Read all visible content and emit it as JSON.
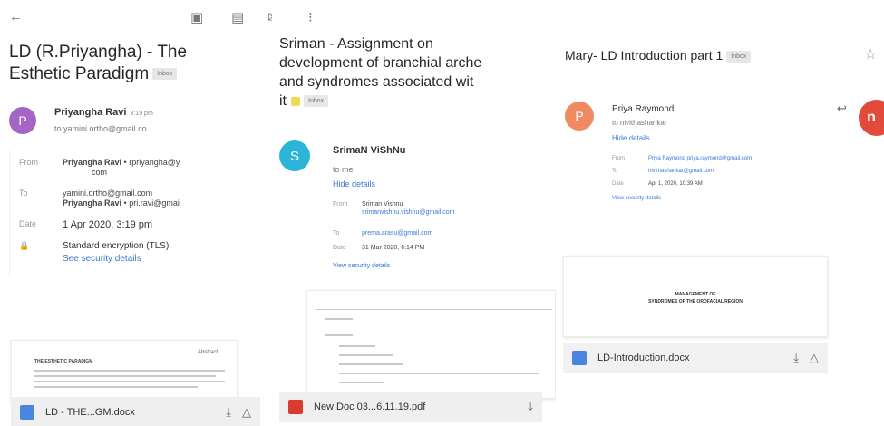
{
  "toolbar": {
    "back_glyph": "←",
    "archive_glyph": "▣",
    "delete_glyph": "▤",
    "mail_glyph": "✉",
    "more_glyph": "⁝"
  },
  "email1": {
    "subject_line1": "LD (R.Priyangha) - The",
    "subject_line2": "Esthetic Paradigm",
    "label": "Inbox",
    "avatar_letter": "P",
    "avatar_color": "#a565c7",
    "sender": "Priyangha Ravi",
    "time": "3:19 pm",
    "to_line": "to yamini.ortho@gmail.co...",
    "details": {
      "from_label": "From",
      "from_value": "Priyangha Ravi",
      "from_email": "• rpriyangha@y",
      "from_email2": "com",
      "to_label": "To",
      "to_value1": "yamini.ortho@gmail.com",
      "to_value2": "Priyangha Ravi",
      "to_value2_email": "• pri.ravi@gmai",
      "date_label": "Date",
      "date_value": "1 Apr 2020, 3:19 pm",
      "security_text": "Standard encryption (TLS).",
      "security_link": "See security details"
    },
    "preview": {
      "heading": "Abstract",
      "title_line": "THE ESTHETIC PARADIGM"
    },
    "attachment": {
      "name": "LD - THE...GM.docx",
      "icon_color": "#4a86e0"
    }
  },
  "email2": {
    "subject_line1": "Sriman - Assignment on",
    "subject_line2": "development of branchial arche",
    "subject_line3": "and syndromes associated wit",
    "subject_line4": "it",
    "label": "Inbox",
    "avatar_letter": "S",
    "avatar_color": "#2bb6d8",
    "sender": "SrimaN ViShNu",
    "to_line": "to me",
    "hide_details": "Hide details",
    "details": {
      "from_label": "From",
      "from_value": "Sriman Vishnu",
      "from_email": "srimanvishnu.vishnu@gmail.com",
      "to_label": "To",
      "to_value": "prema.arasu@gmail.com",
      "date_label": "Date",
      "date_value": "31 Mar 2020, 6:14 PM",
      "security_link": "View security details"
    },
    "attachment": {
      "name": "New Doc 03...6.11.19.pdf",
      "icon_color": "#d93b30"
    }
  },
  "email3": {
    "subject": "Mary- LD Introduction part 1",
    "label": "Inbox",
    "star_glyph": "☆",
    "avatar_letter": "P",
    "avatar_color": "#f08a62",
    "sender": "Priya Raymond",
    "to_line": "to nivithashankar",
    "hide_details": "Hide details",
    "reply_glyph": "↩",
    "edge_avatar_letter": "n",
    "details": {
      "from_label": "From",
      "from_value": "Priya Raymond",
      "from_email": "priya.raymond@gmail.com",
      "to_label": "To",
      "to_value": "nivithashankar@gmail.com",
      "date_label": "Date",
      "date_value": "Apr 1, 2020, 10:39 AM",
      "security_link": "View security details"
    },
    "preview": {
      "title1": "MANAGEMENT OF",
      "title2": "SYNDROMES OF THE OROFACIAL REGION"
    },
    "attachment": {
      "name": "LD-Introduction.docx",
      "icon_color": "#4a86e0"
    }
  },
  "actions": {
    "download_glyph": "⤓",
    "drive_glyph": "△"
  }
}
